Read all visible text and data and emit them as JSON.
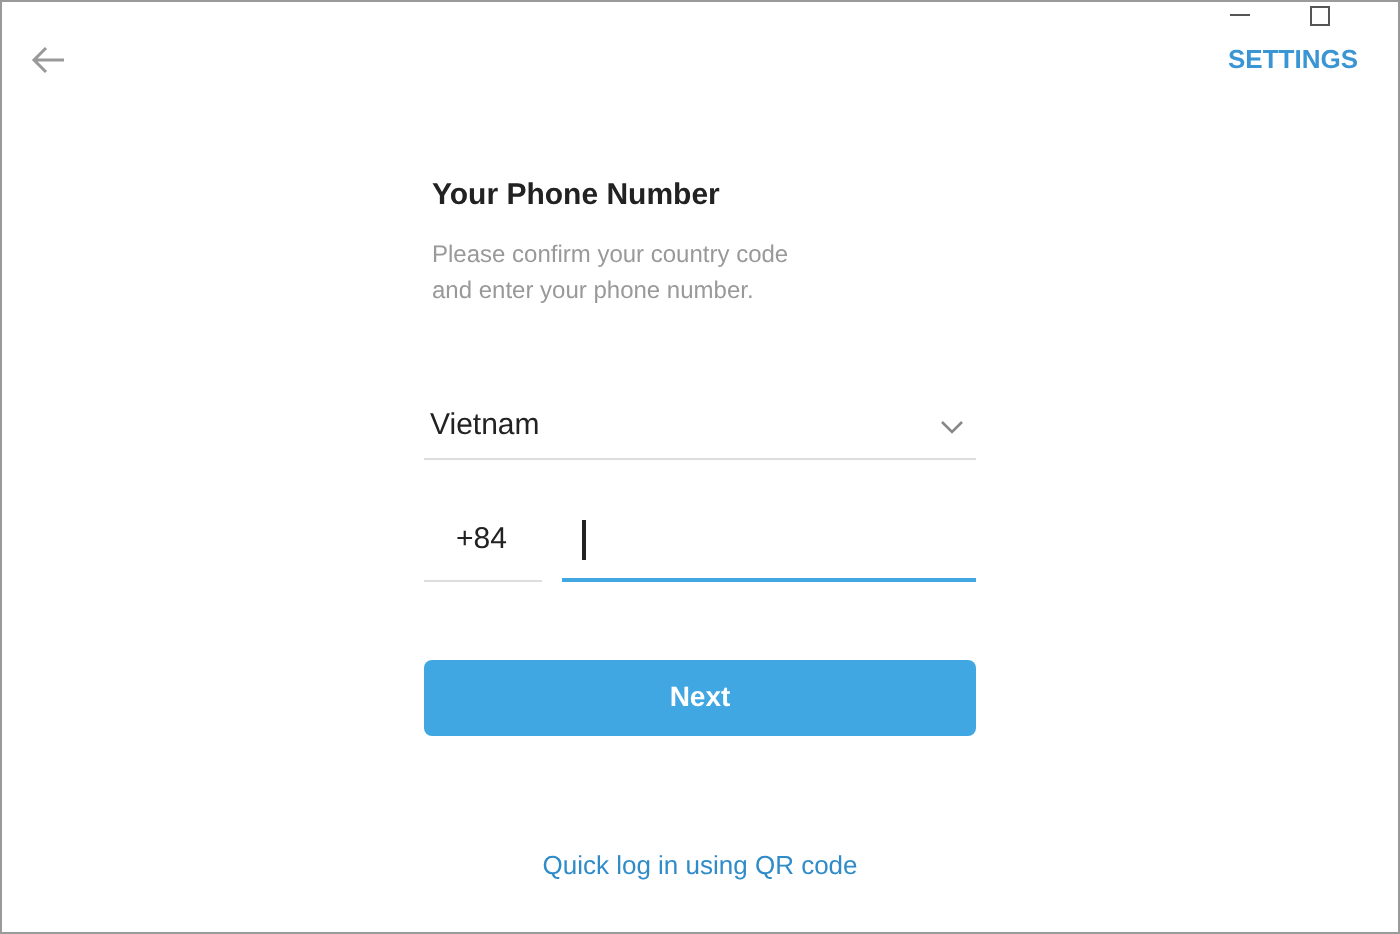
{
  "header": {
    "settings": "SETTINGS"
  },
  "form": {
    "title": "Your Phone Number",
    "subtitle": "Please confirm your country code and enter your phone number.",
    "country": "Vietnam",
    "code": "+84",
    "phone": {
      "focused": true
    },
    "next": "Next"
  },
  "qr_link": "Quick log in using QR code"
}
